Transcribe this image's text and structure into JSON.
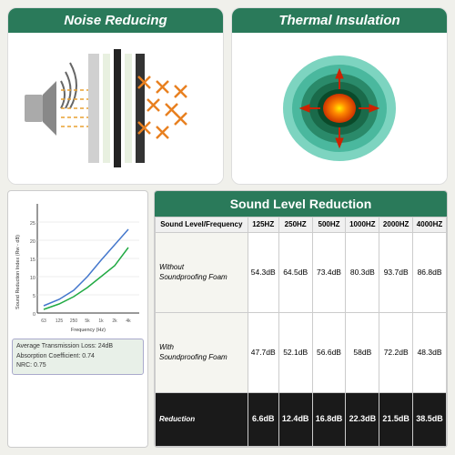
{
  "top": {
    "noise_label": "Noise Reducing",
    "thermal_label": "Thermal Insulation"
  },
  "chart": {
    "y_axis_label": "Sound Reduction Index (Rw - dB)",
    "x_axis_label": "Frequency (Hz)",
    "info_line1": "Average Transmission Loss: 24dB",
    "info_line2": "Absorption Coefficient: 0.74",
    "info_line3": "NRC: 0.75"
  },
  "table": {
    "title": "Sound Level Reduction",
    "headers": [
      "Sound Level/Frequency",
      "125HZ",
      "250HZ",
      "500HZ",
      "1000HZ",
      "2000HZ",
      "4000HZ"
    ],
    "row_without_label": "Without\nSoundproofing Foam",
    "row_without": [
      "54.3dB",
      "64.5dB",
      "73.4dB",
      "80.3dB",
      "93.7dB",
      "86.8dB"
    ],
    "row_with_label": "With\nSoundproofing Foam",
    "row_with": [
      "47.7dB",
      "52.1dB",
      "56.6dB",
      "58dB",
      "72.2dB",
      "48.3dB"
    ],
    "reduction_label": "Reduction",
    "reduction": [
      "6.6dB",
      "12.4dB",
      "16.8dB",
      "22.3dB",
      "21.5dB",
      "38.5dB"
    ]
  }
}
